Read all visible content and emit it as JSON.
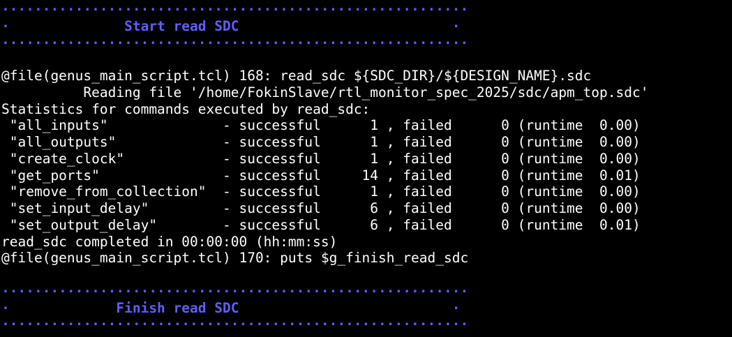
{
  "colors": {
    "background": "#000000",
    "text": "#ffffff",
    "banner": "#5f5fff"
  },
  "lines": [
    {
      "text": "·························································",
      "style": "banner"
    },
    {
      "text": "·              Start read SDC                          ·",
      "style": "banner"
    },
    {
      "text": "·························································",
      "style": "banner"
    },
    {
      "text": "",
      "style": "plain"
    },
    {
      "text": "@file(genus_main_script.tcl) 168: read_sdc ${SDC_DIR}/${DESIGN_NAME}.sdc",
      "style": "plain"
    },
    {
      "text": "          Reading file '/home/FokinSlave/rtl_monitor_spec_2025/sdc/apm_top.sdc'",
      "style": "plain"
    },
    {
      "text": "Statistics for commands executed by read_sdc:",
      "style": "plain"
    },
    {
      "text": " \"all_inputs\"              - successful      1 , failed      0 (runtime  0.00)",
      "style": "plain"
    },
    {
      "text": " \"all_outputs\"             - successful      1 , failed      0 (runtime  0.00)",
      "style": "plain"
    },
    {
      "text": " \"create_clock\"            - successful      1 , failed      0 (runtime  0.00)",
      "style": "plain"
    },
    {
      "text": " \"get_ports\"               - successful     14 , failed      0 (runtime  0.01)",
      "style": "plain"
    },
    {
      "text": " \"remove_from_collection\"  - successful      1 , failed      0 (runtime  0.00)",
      "style": "plain"
    },
    {
      "text": " \"set_input_delay\"         - successful      6 , failed      0 (runtime  0.00)",
      "style": "plain"
    },
    {
      "text": " \"set_output_delay\"        - successful      6 , failed      0 (runtime  0.01)",
      "style": "plain"
    },
    {
      "text": "read_sdc completed in 00:00:00 (hh:mm:ss)",
      "style": "plain"
    },
    {
      "text": "@file(genus_main_script.tcl) 170: puts $g_finish_read_sdc",
      "style": "plain"
    },
    {
      "text": "",
      "style": "plain"
    },
    {
      "text": "·························································",
      "style": "banner"
    },
    {
      "text": "·             Finish read SDC                          ·",
      "style": "banner"
    },
    {
      "text": "·························································",
      "style": "banner"
    }
  ]
}
